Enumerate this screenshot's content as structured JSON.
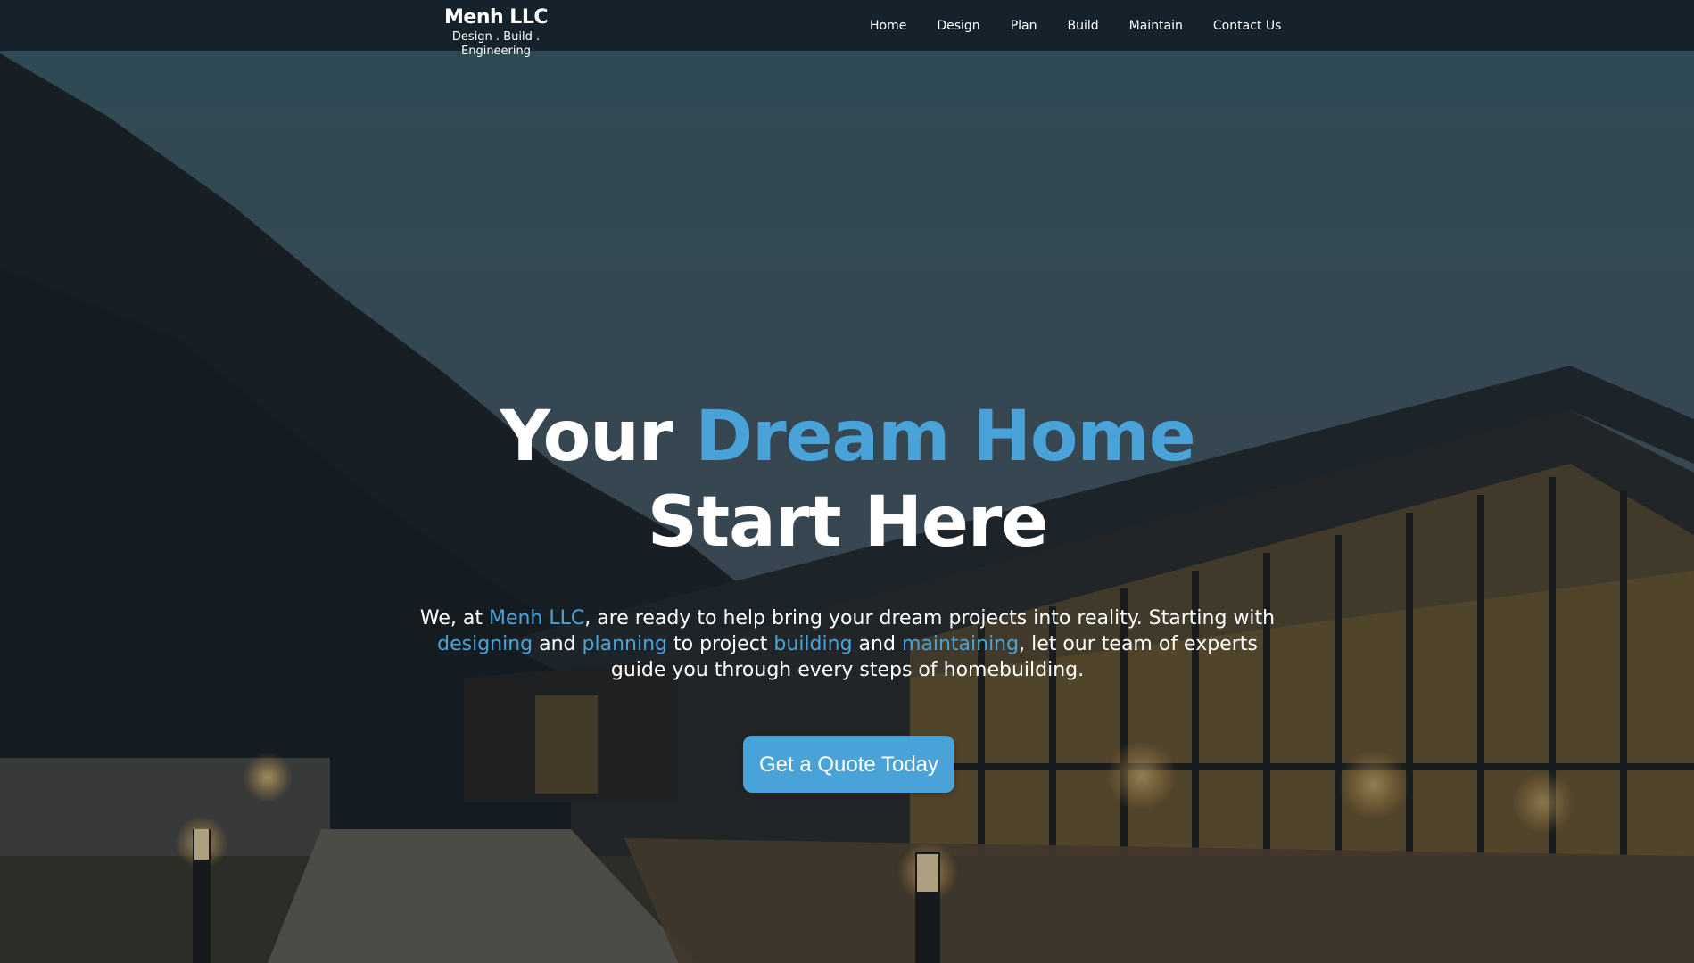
{
  "header": {
    "brand_name": "Menh LLC",
    "brand_tagline": "Design . Build . Engineering",
    "nav": [
      "Home",
      "Design",
      "Plan",
      "Build",
      "Maintain",
      "Contact Us"
    ]
  },
  "hero": {
    "headline": {
      "part1": "Your ",
      "accent": "Dream Home",
      "part2": " Start Here"
    },
    "intro": {
      "t1": "We, at ",
      "a1": "Menh LLC",
      "t2": ", are ready to help bring your dream projects into reality. Starting with ",
      "a2": "designing",
      "t3": " and ",
      "a3": "planning",
      "t4": " to project ",
      "a4": "building",
      "t5": " and ",
      "a5": "maintaining",
      "t6": ", let our team of experts guide you through every steps of homebuilding."
    },
    "cta_label": "Get a Quote Today"
  },
  "colors": {
    "accent": "#4aa3d8",
    "navbar": "#15222b",
    "text": "#ffffff"
  },
  "background": {
    "image_subject": "modern wood-and-glass building at dusk with forested hillside and lit stone pathway"
  }
}
